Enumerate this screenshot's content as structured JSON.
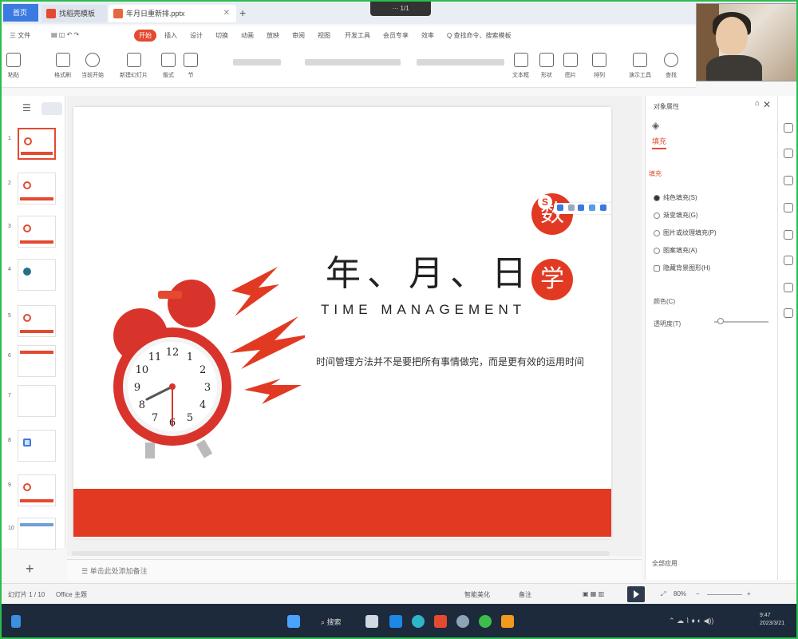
{
  "tabs": {
    "home": "首页",
    "tab1": "找稻壳模板",
    "tab2": "年月日重新排.pptx"
  },
  "meeting": "··· 1/1",
  "menu": [
    {
      "label": "三 文件"
    },
    {
      "label": "开始",
      "active": true
    },
    {
      "label": "插入"
    },
    {
      "label": "设计"
    },
    {
      "label": "切换"
    },
    {
      "label": "动画"
    },
    {
      "label": "放映"
    },
    {
      "label": "审阅"
    },
    {
      "label": "视图"
    },
    {
      "label": "开发工具"
    },
    {
      "label": "会员专享"
    },
    {
      "label": "效率"
    },
    {
      "label": "Q 查找命令、搜索模板"
    }
  ],
  "toolbar": [
    "粘贴",
    "格式刷",
    "当前开始",
    "新建幻灯片",
    "版式",
    "节",
    "文本框",
    "形状",
    "图片",
    "排列",
    "演示工具",
    "查找"
  ],
  "slide": {
    "title": "年、月、日",
    "subtitle": "TIME MANAGEMENT",
    "description": "时间管理方法并不是要把所有事情做完，而是更有效的运用时间",
    "stamp1": "数",
    "stamp2": "学",
    "stamp_s": "S",
    "clock_numbers": [
      "12",
      "1",
      "2",
      "3",
      "4",
      "5",
      "6",
      "7",
      "8",
      "9",
      "10",
      "11"
    ]
  },
  "thumbnails": [
    "1",
    "2",
    "3",
    "4",
    "5",
    "6",
    "7",
    "8",
    "9",
    "10"
  ],
  "notes": "单击此处添加备注",
  "rightpanel": {
    "title": "对象属性",
    "tab": "填充",
    "section": "填充",
    "options": [
      {
        "label": "纯色填充(S)",
        "checked": true
      },
      {
        "label": "渐变填充(G)",
        "checked": false
      },
      {
        "label": "图片或纹理填充(P)",
        "checked": false
      },
      {
        "label": "图案填充(A)",
        "checked": false
      },
      {
        "label": "隐藏背景图形(H)",
        "checked": false
      }
    ],
    "color_label": "颜色(C)",
    "transparency_label": "透明度(T)",
    "bottom_label": "全部应用"
  },
  "status": {
    "slide_pos": "幻灯片 1 / 10",
    "theme": "Office 主题",
    "smart": "智能美化",
    "notes_btn": "备注",
    "zoom": "80%"
  },
  "taskbar": {
    "search": "搜索",
    "time": "9:47",
    "date": "2023/3/21"
  },
  "colors": {
    "accent": "#e34a2f",
    "slide_red": "#e23a22",
    "taskbar": "#1d2a3c",
    "frame": "#2dbb4e"
  }
}
